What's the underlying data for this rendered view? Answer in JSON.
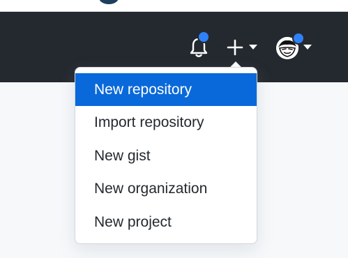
{
  "header": {
    "icons": {
      "notifications": "bell-icon",
      "create": "plus-icon",
      "create_caret": "chevron-down-icon",
      "profile": "avatar-icon",
      "profile_caret": "chevron-down-icon"
    },
    "indicator_color": "#2f81f7",
    "background_color": "#24292f"
  },
  "create_menu": {
    "items": [
      {
        "label": "New repository",
        "selected": true
      },
      {
        "label": "Import repository",
        "selected": false
      },
      {
        "label": "New gist",
        "selected": false
      },
      {
        "label": "New organization",
        "selected": false
      },
      {
        "label": "New project",
        "selected": false
      }
    ],
    "highlight_color": "#0969da"
  }
}
